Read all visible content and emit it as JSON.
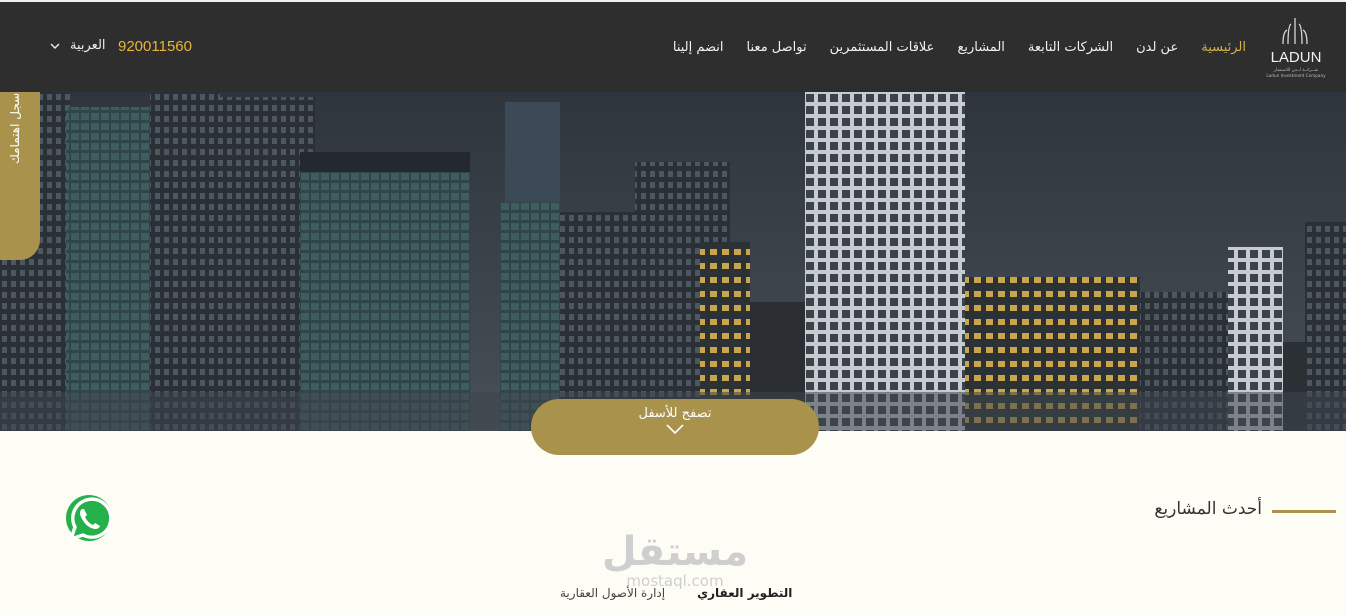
{
  "brand": {
    "logo_text": "LADUN",
    "logo_subtitle_ar": "شــركــة لــدن للاستثمار",
    "logo_subtitle_en": "Ladun Investment Company",
    "accent_color": "#a8924c",
    "nav_bg": "#2e2e2e"
  },
  "nav": {
    "items": [
      {
        "label": "الرئيسية",
        "active": true
      },
      {
        "label": "عن لدن",
        "active": false
      },
      {
        "label": "الشركات التابعة",
        "active": false
      },
      {
        "label": "المشاريع",
        "active": false
      },
      {
        "label": "علاقات المستثمرين",
        "active": false
      },
      {
        "label": "تواصل معنا",
        "active": false
      },
      {
        "label": "انضم إلينا",
        "active": false
      }
    ]
  },
  "header": {
    "phone": "920011560",
    "language": "العربية"
  },
  "side_tab": {
    "label": "سجل اهتمامك"
  },
  "hero": {
    "scroll_label": "تصفح للأسفل"
  },
  "section": {
    "title": "أحدث المشاريع"
  },
  "watermark": {
    "text_ar": "مستقل",
    "text_en": "mostaql.com"
  },
  "tabs": [
    {
      "label": "التطوير العقاري",
      "active": true
    },
    {
      "label": "إدارة الأصول العقارية",
      "active": false
    }
  ],
  "icons": {
    "whatsapp": "whatsapp-icon",
    "chevron": "chevron-down-icon"
  }
}
